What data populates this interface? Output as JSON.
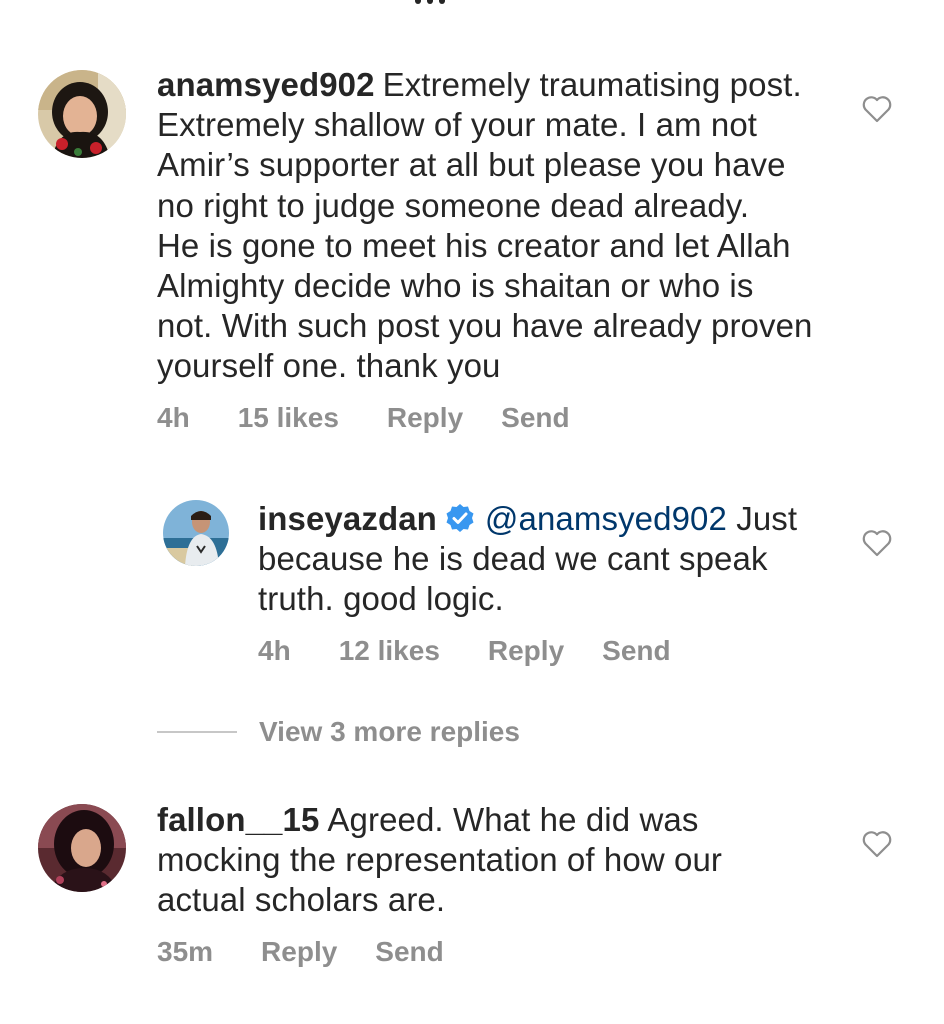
{
  "comments": [
    {
      "username": "anamsyed902",
      "text_lines": [
        "Extremely traumatising post.",
        "Extremely shallow of your mate. I am not",
        "Amir’s supporter at all but please you have",
        "no right to judge someone dead already.",
        "He is gone to meet his creator and let Allah",
        "Almighty decide who is shaitan or who is",
        "not. With such post you have already proven",
        "yourself one. thank you"
      ],
      "time": "4h",
      "likes": "15 likes",
      "reply_label": "Reply",
      "send_label": "Send",
      "avatar_icon": "profile-photo-woman-red",
      "like_icon": "heart-outline-icon"
    },
    {
      "username": "inseyazdan",
      "verified_icon": "verified-badge-icon",
      "mention": "@anamsyed902",
      "text_lines": [
        "Just",
        "because he is dead we cant speak",
        "truth. good logic."
      ],
      "time": "4h",
      "likes": "12 likes",
      "reply_label": "Reply",
      "send_label": "Send",
      "avatar_icon": "profile-photo-man-beach",
      "like_icon": "heart-outline-icon"
    },
    {
      "username": "fallon__15",
      "text_lines": [
        "Agreed. What he did was",
        "mocking the representation of how our",
        "actual scholars are."
      ],
      "time": "35m",
      "reply_label": "Reply",
      "send_label": "Send",
      "avatar_icon": "profile-photo-woman-dark",
      "like_icon": "heart-outline-icon"
    }
  ],
  "view_more_replies": "View 3 more replies",
  "colors": {
    "text": "#262626",
    "secondary": "#8e8e8e",
    "mention": "#00376b",
    "verified": "#3897f0",
    "divider": "#c7c7c7"
  }
}
